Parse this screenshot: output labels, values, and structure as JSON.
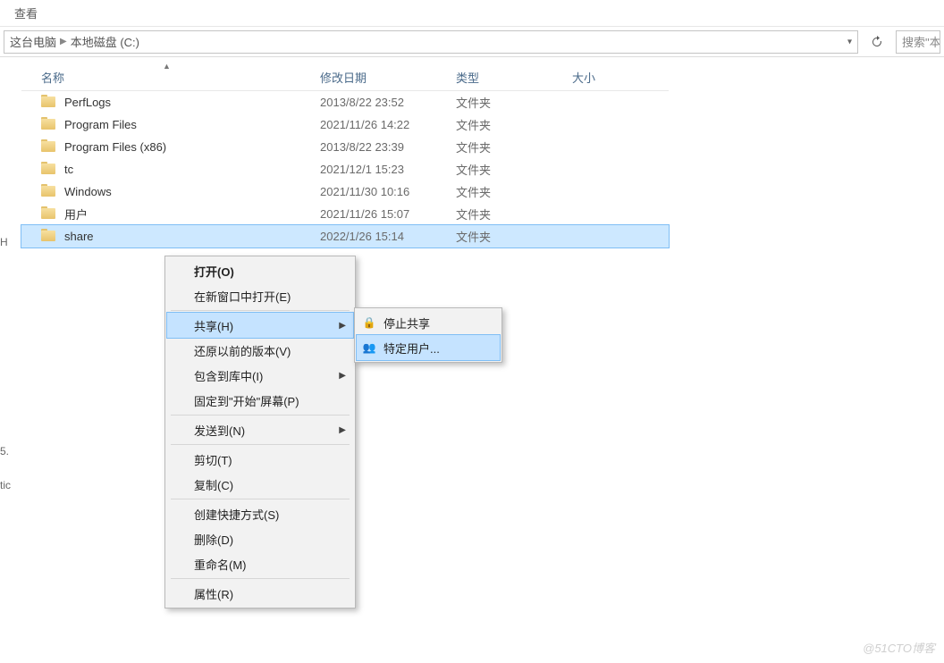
{
  "menubar": {
    "view": "查看"
  },
  "breadcrumb": {
    "pc": "这台电脑",
    "drive": "本地磁盘 (C:)"
  },
  "search": {
    "placeholder": "搜索\"本"
  },
  "columns": {
    "name": "名称",
    "date": "修改日期",
    "type": "类型",
    "size": "大小"
  },
  "rows": [
    {
      "name": "PerfLogs",
      "date": "2013/8/22 23:52",
      "type": "文件夹",
      "selected": false
    },
    {
      "name": "Program Files",
      "date": "2021/11/26 14:22",
      "type": "文件夹",
      "selected": false
    },
    {
      "name": "Program Files (x86)",
      "date": "2013/8/22 23:39",
      "type": "文件夹",
      "selected": false
    },
    {
      "name": "tc",
      "date": "2021/12/1 15:23",
      "type": "文件夹",
      "selected": false
    },
    {
      "name": "Windows",
      "date": "2021/11/30 10:16",
      "type": "文件夹",
      "selected": false
    },
    {
      "name": "用户",
      "date": "2021/11/26 15:07",
      "type": "文件夹",
      "selected": false
    },
    {
      "name": "share",
      "date": "2022/1/26 15:14",
      "type": "文件夹",
      "selected": true
    }
  ],
  "ctx": {
    "open": "打开(O)",
    "open_new": "在新窗口中打开(E)",
    "share": "共享(H)",
    "restore": "还原以前的版本(V)",
    "include": "包含到库中(I)",
    "pin": "固定到\"开始\"屏幕(P)",
    "sendto": "发送到(N)",
    "cut": "剪切(T)",
    "copy": "复制(C)",
    "shortcut": "创建快捷方式(S)",
    "delete": "删除(D)",
    "rename": "重命名(M)",
    "props": "属性(R)"
  },
  "sub": {
    "stop": "停止共享",
    "specific": "特定用户..."
  },
  "left_fragments": [
    "5.",
    "tic"
  ],
  "left_char": "H",
  "watermark": "@51CTO博客"
}
